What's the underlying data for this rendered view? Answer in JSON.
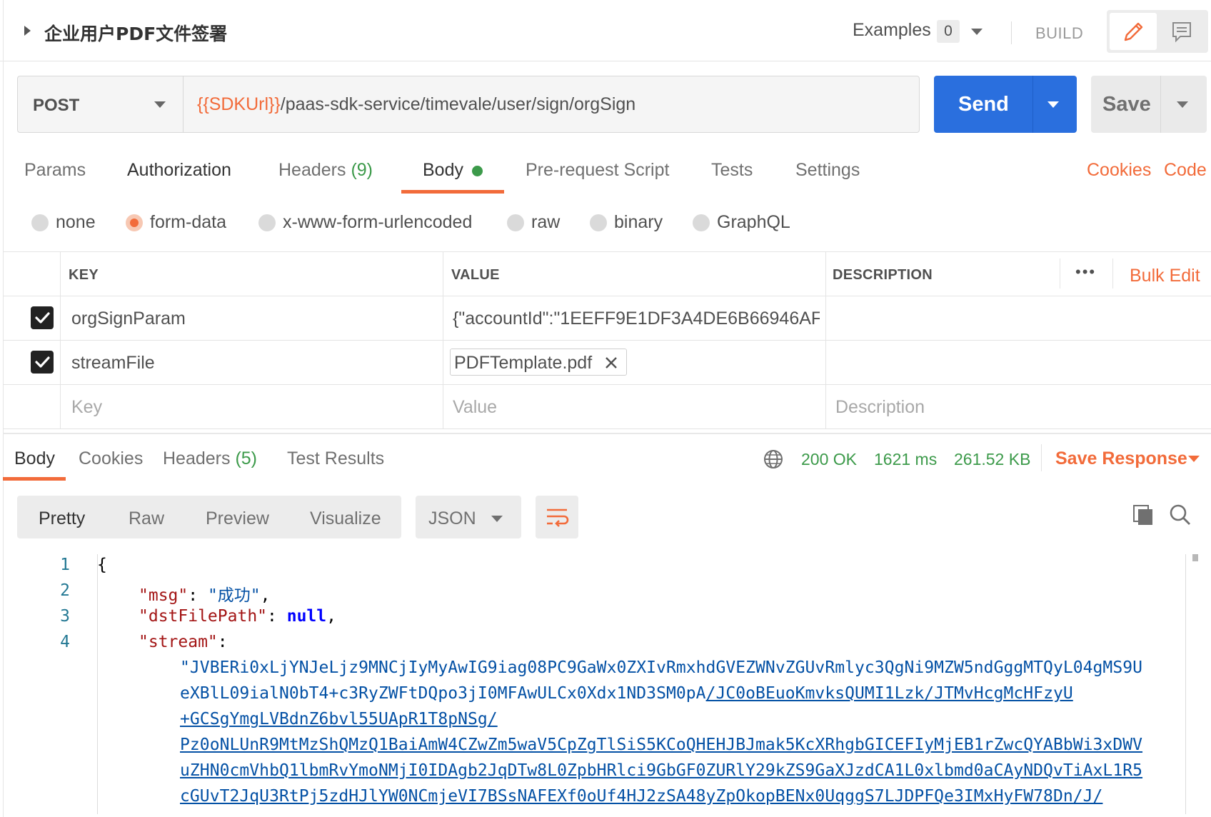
{
  "request": {
    "title": "企业用户PDF文件签署",
    "examples_label": "Examples",
    "examples_count": "0",
    "build_label": "BUILD",
    "method": "POST",
    "url_variable": "{{SDKUrl}}",
    "url_path": "/paas-sdk-service/timevale/user/sign/orgSign",
    "send_label": "Send",
    "save_label": "Save"
  },
  "request_tabs": {
    "params": "Params",
    "authorization": "Authorization",
    "headers": "Headers",
    "headers_count": "(9)",
    "body": "Body",
    "prerequest": "Pre-request Script",
    "tests": "Tests",
    "settings": "Settings",
    "cookies": "Cookies",
    "code": "Code",
    "active": "Body"
  },
  "body_types": {
    "none": "none",
    "form_data": "form-data",
    "urlencoded": "x-www-form-urlencoded",
    "raw": "raw",
    "binary": "binary",
    "graphql": "GraphQL",
    "selected": "form-data"
  },
  "params_table": {
    "col_key": "KEY",
    "col_value": "VALUE",
    "col_description": "DESCRIPTION",
    "more": "•••",
    "bulk_edit": "Bulk Edit",
    "rows": [
      {
        "checked": true,
        "key": "orgSignParam",
        "value": "{\"accountId\":\"1EEFF9E1DF3A4DE6B66946AF...",
        "description": ""
      },
      {
        "checked": true,
        "key": "streamFile",
        "value": "PDFTemplate.pdf",
        "description": ""
      }
    ],
    "placeholder": {
      "key": "Key",
      "value": "Value",
      "description": "Description"
    }
  },
  "response": {
    "tabs": {
      "body": "Body",
      "cookies": "Cookies",
      "headers": "Headers",
      "headers_count": "(5)",
      "test_results": "Test Results",
      "active": "Body"
    },
    "status": "200 OK",
    "time": "1621 ms",
    "size": "261.52 KB",
    "save_response": "Save Response",
    "views": {
      "pretty": "Pretty",
      "raw": "Raw",
      "preview": "Preview",
      "visualize": "Visualize",
      "active": "Pretty"
    },
    "format": "JSON"
  },
  "code": {
    "line_numbers": [
      "1",
      "2",
      "3",
      "4"
    ],
    "brace": "{",
    "msg_key": "\"msg\"",
    "msg_value": "\"成功\"",
    "dst_key": "\"dstFilePath\"",
    "dst_value": "null",
    "stream_key": "\"stream\"",
    "stream_lines": [
      {
        "plain": "\"JVBERi0xLjYNJeLjz9MNCjIyMyAwIG9iag08PC9GaWx0ZXIvRmxhdGVEZWNvZGUvRmlyc3QgNi9MZW5ndGggMTQyL04gMS9U",
        "link": ""
      },
      {
        "plain": "eXBlL09ialN0bT4+c3RyZWFtDQpo3jI0MFAwULCx0Xdx1ND3SM0pA",
        "link": "/JC0oBEuoKmvksQUMI1Lzk/JTMvHcgMcHFzyU"
      },
      {
        "plain": "",
        "link": "+GCSgYmgLVBdnZ6bvl55UApR1T8pNSg/"
      },
      {
        "plain": "",
        "link": "Pz0oNLUnR9MtMzShQMzQ1BaiAmW4CZwZm5waV5CpZgTlSiS5KCoQHEHJBJmak5KcXRhgbGICEFIyMjEB1rZwcQYABbWi3xDWV"
      },
      {
        "plain": "",
        "link": "uZHN0cmVhbQ1lbmRvYmoNMjI0IDAgb2JqDTw8L0ZpbHRlci9GbGF0ZURlY29kZS9GaXJzdCA1L0xlbmd0aCAyNDQvTiAxL1R5"
      },
      {
        "plain": "",
        "link": "cGUvT2JqU3RtPj5zdHJlYW0NCmjeVI7BSsNAFEXf0oUf4HJ2zSA48yZpOkopBENx0UqggS7LJDPFQe3IMxHyFW78Dn/J/"
      }
    ]
  }
}
